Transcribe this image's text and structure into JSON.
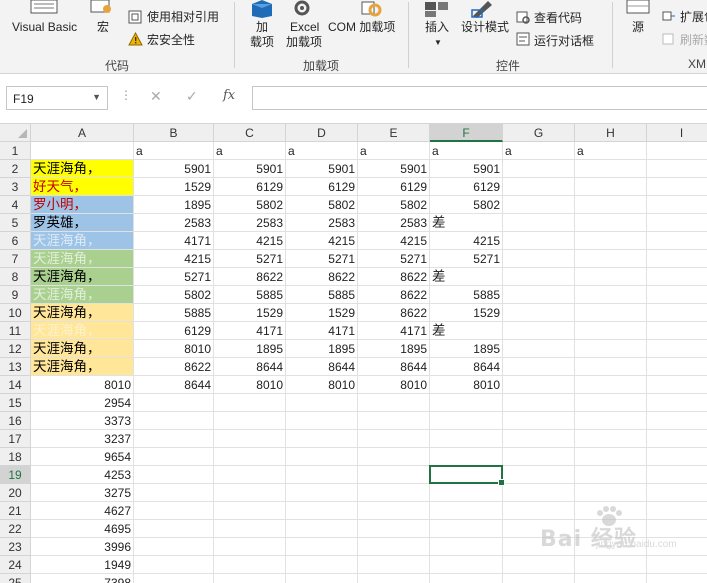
{
  "ribbon": {
    "visual_basic": "Visual Basic",
    "macro": "宏",
    "use_relative_ref": "使用相对引用",
    "macro_security": "宏安全性",
    "group_code": "代码",
    "addins": "加载项",
    "addins_line2": "",
    "excel_addins_line1": "Excel",
    "excel_addins_line2": "加载项",
    "com_addins": "COM 加载项",
    "group_addins": "加载项",
    "insert": "插入",
    "design_mode": "设计模式",
    "view_code": "查看代码",
    "run_dialog": "运行对话框",
    "group_controls": "控件",
    "source": "源",
    "expand_pack": "扩展包",
    "refresh_data": "刷新数",
    "group_xml": "XML",
    "addins_l1": "加",
    "addins_l2": "载项"
  },
  "formula_bar": {
    "name_box": "F19",
    "cancel_glyph": "✕",
    "enter_glyph": "✓",
    "fx": "fx",
    "formula": ""
  },
  "sheet": {
    "columns": [
      "A",
      "B",
      "C",
      "D",
      "E",
      "F",
      "G",
      "H",
      "I"
    ],
    "selected_column": "F",
    "selected_row": 19,
    "row_numbers": [
      1,
      2,
      3,
      4,
      5,
      6,
      7,
      8,
      9,
      10,
      11,
      12,
      13,
      14,
      15,
      16,
      17,
      18,
      19,
      20,
      21,
      22,
      23,
      24,
      25
    ],
    "rows": [
      [
        "",
        "a",
        "a",
        "a",
        "a",
        "a",
        "a",
        "a",
        ""
      ],
      [
        "天涯海角，",
        "5901",
        "5901",
        "5901",
        "5901",
        "5901",
        "",
        "",
        ""
      ],
      [
        "好天气，",
        "1529",
        "6129",
        "6129",
        "6129",
        "6129",
        "",
        "",
        ""
      ],
      [
        "罗小明，",
        "1895",
        "5802",
        "5802",
        "5802",
        "5802",
        "",
        "",
        ""
      ],
      [
        "罗英雄，",
        "2583",
        "2583",
        "2583",
        "2583",
        "差",
        "",
        "",
        ""
      ],
      [
        "天涯海角，",
        "4171",
        "4215",
        "4215",
        "4215",
        "4215",
        "",
        "",
        ""
      ],
      [
        "天涯海角，",
        "4215",
        "5271",
        "5271",
        "5271",
        "5271",
        "",
        "",
        ""
      ],
      [
        "天涯海角，",
        "5271",
        "8622",
        "8622",
        "8622",
        "差",
        "",
        "",
        ""
      ],
      [
        "天涯海角，",
        "5802",
        "5885",
        "5885",
        "8622",
        "5885",
        "",
        "",
        ""
      ],
      [
        "天涯海角，",
        "5885",
        "1529",
        "1529",
        "8622",
        "1529",
        "",
        "",
        ""
      ],
      [
        "天涯海角，",
        "6129",
        "4171",
        "4171",
        "4171",
        "差",
        "",
        "",
        ""
      ],
      [
        "天涯海角，",
        "8010",
        "1895",
        "1895",
        "1895",
        "1895",
        "",
        "",
        ""
      ],
      [
        "天涯海角，",
        "8622",
        "8644",
        "8644",
        "8644",
        "8644",
        "",
        "",
        ""
      ],
      [
        "8010",
        "8644",
        "8010",
        "8010",
        "8010",
        "8010",
        "",
        "",
        ""
      ],
      [
        "2954",
        "",
        "",
        "",
        "",
        "",
        "",
        "",
        ""
      ],
      [
        "3373",
        "",
        "",
        "",
        "",
        "",
        "",
        "",
        ""
      ],
      [
        "3237",
        "",
        "",
        "",
        "",
        "",
        "",
        "",
        ""
      ],
      [
        "9654",
        "",
        "",
        "",
        "",
        "",
        "",
        "",
        ""
      ],
      [
        "4253",
        "",
        "",
        "",
        "",
        "",
        "",
        "",
        ""
      ],
      [
        "3275",
        "",
        "",
        "",
        "",
        "",
        "",
        "",
        ""
      ],
      [
        "4627",
        "",
        "",
        "",
        "",
        "",
        "",
        "",
        ""
      ],
      [
        "4695",
        "",
        "",
        "",
        "",
        "",
        "",
        "",
        ""
      ],
      [
        "3996",
        "",
        "",
        "",
        "",
        "",
        "",
        "",
        ""
      ],
      [
        "1949",
        "",
        "",
        "",
        "",
        "",
        "",
        "",
        ""
      ],
      [
        "7398",
        "",
        "",
        "",
        "",
        "",
        "",
        "",
        ""
      ]
    ],
    "a_column_fill": [
      "#ffffff",
      "#ffff00",
      "#ffff00",
      "#9dc3e6",
      "#9dc3e6",
      "#9dc3e6",
      "#a9d08e",
      "#a9d08e",
      "#a9d08e",
      "#ffe699",
      "#ffe699",
      "#ffe699",
      "#ffe699"
    ],
    "a_column_text_color": [
      "#000000",
      "#000000",
      "#c00000",
      "#c00000",
      "#000000",
      "#ddebf7",
      "#e2efda",
      "#000000",
      "#e2efda",
      "#000000",
      "#fff2cc",
      "#000000",
      "#000000"
    ]
  },
  "watermark": {
    "brand": "Bai 经验",
    "sub": "jingyan.baidu.com"
  },
  "colors": {
    "excel_green": "#217346",
    "ribbon_bg": "#f3f3f3",
    "gridline": "#e1e1e1",
    "header_bg": "#efefef"
  }
}
